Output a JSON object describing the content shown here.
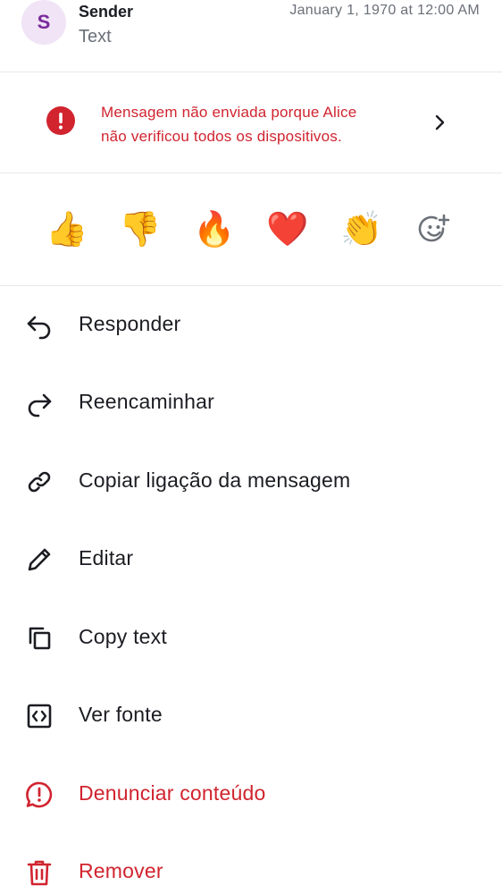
{
  "message": {
    "avatar_letter": "S",
    "sender": "Sender",
    "text": "Text",
    "timestamp": "January 1, 1970 at 12:00 AM"
  },
  "warning": {
    "line1": "Mensagem não enviada porque Alice",
    "line2": "não verificou todos os dispositivos."
  },
  "reactions": [
    "👍",
    "👎",
    "🔥",
    "❤️",
    "👏"
  ],
  "menu": {
    "reply": "Responder",
    "forward": "Reencaminhar",
    "copy_link": "Copiar ligação da mensagem",
    "edit": "Editar",
    "copy_text": "Copy text",
    "view_source": "Ver fonte",
    "report": "Denunciar conteúdo",
    "remove": "Remover"
  },
  "colors": {
    "danger": "#d1242f",
    "avatar_bg": "#f0e4f6",
    "avatar_fg": "#7a2a9b",
    "text_primary": "#1b1d22",
    "text_secondary": "#6b7078"
  }
}
